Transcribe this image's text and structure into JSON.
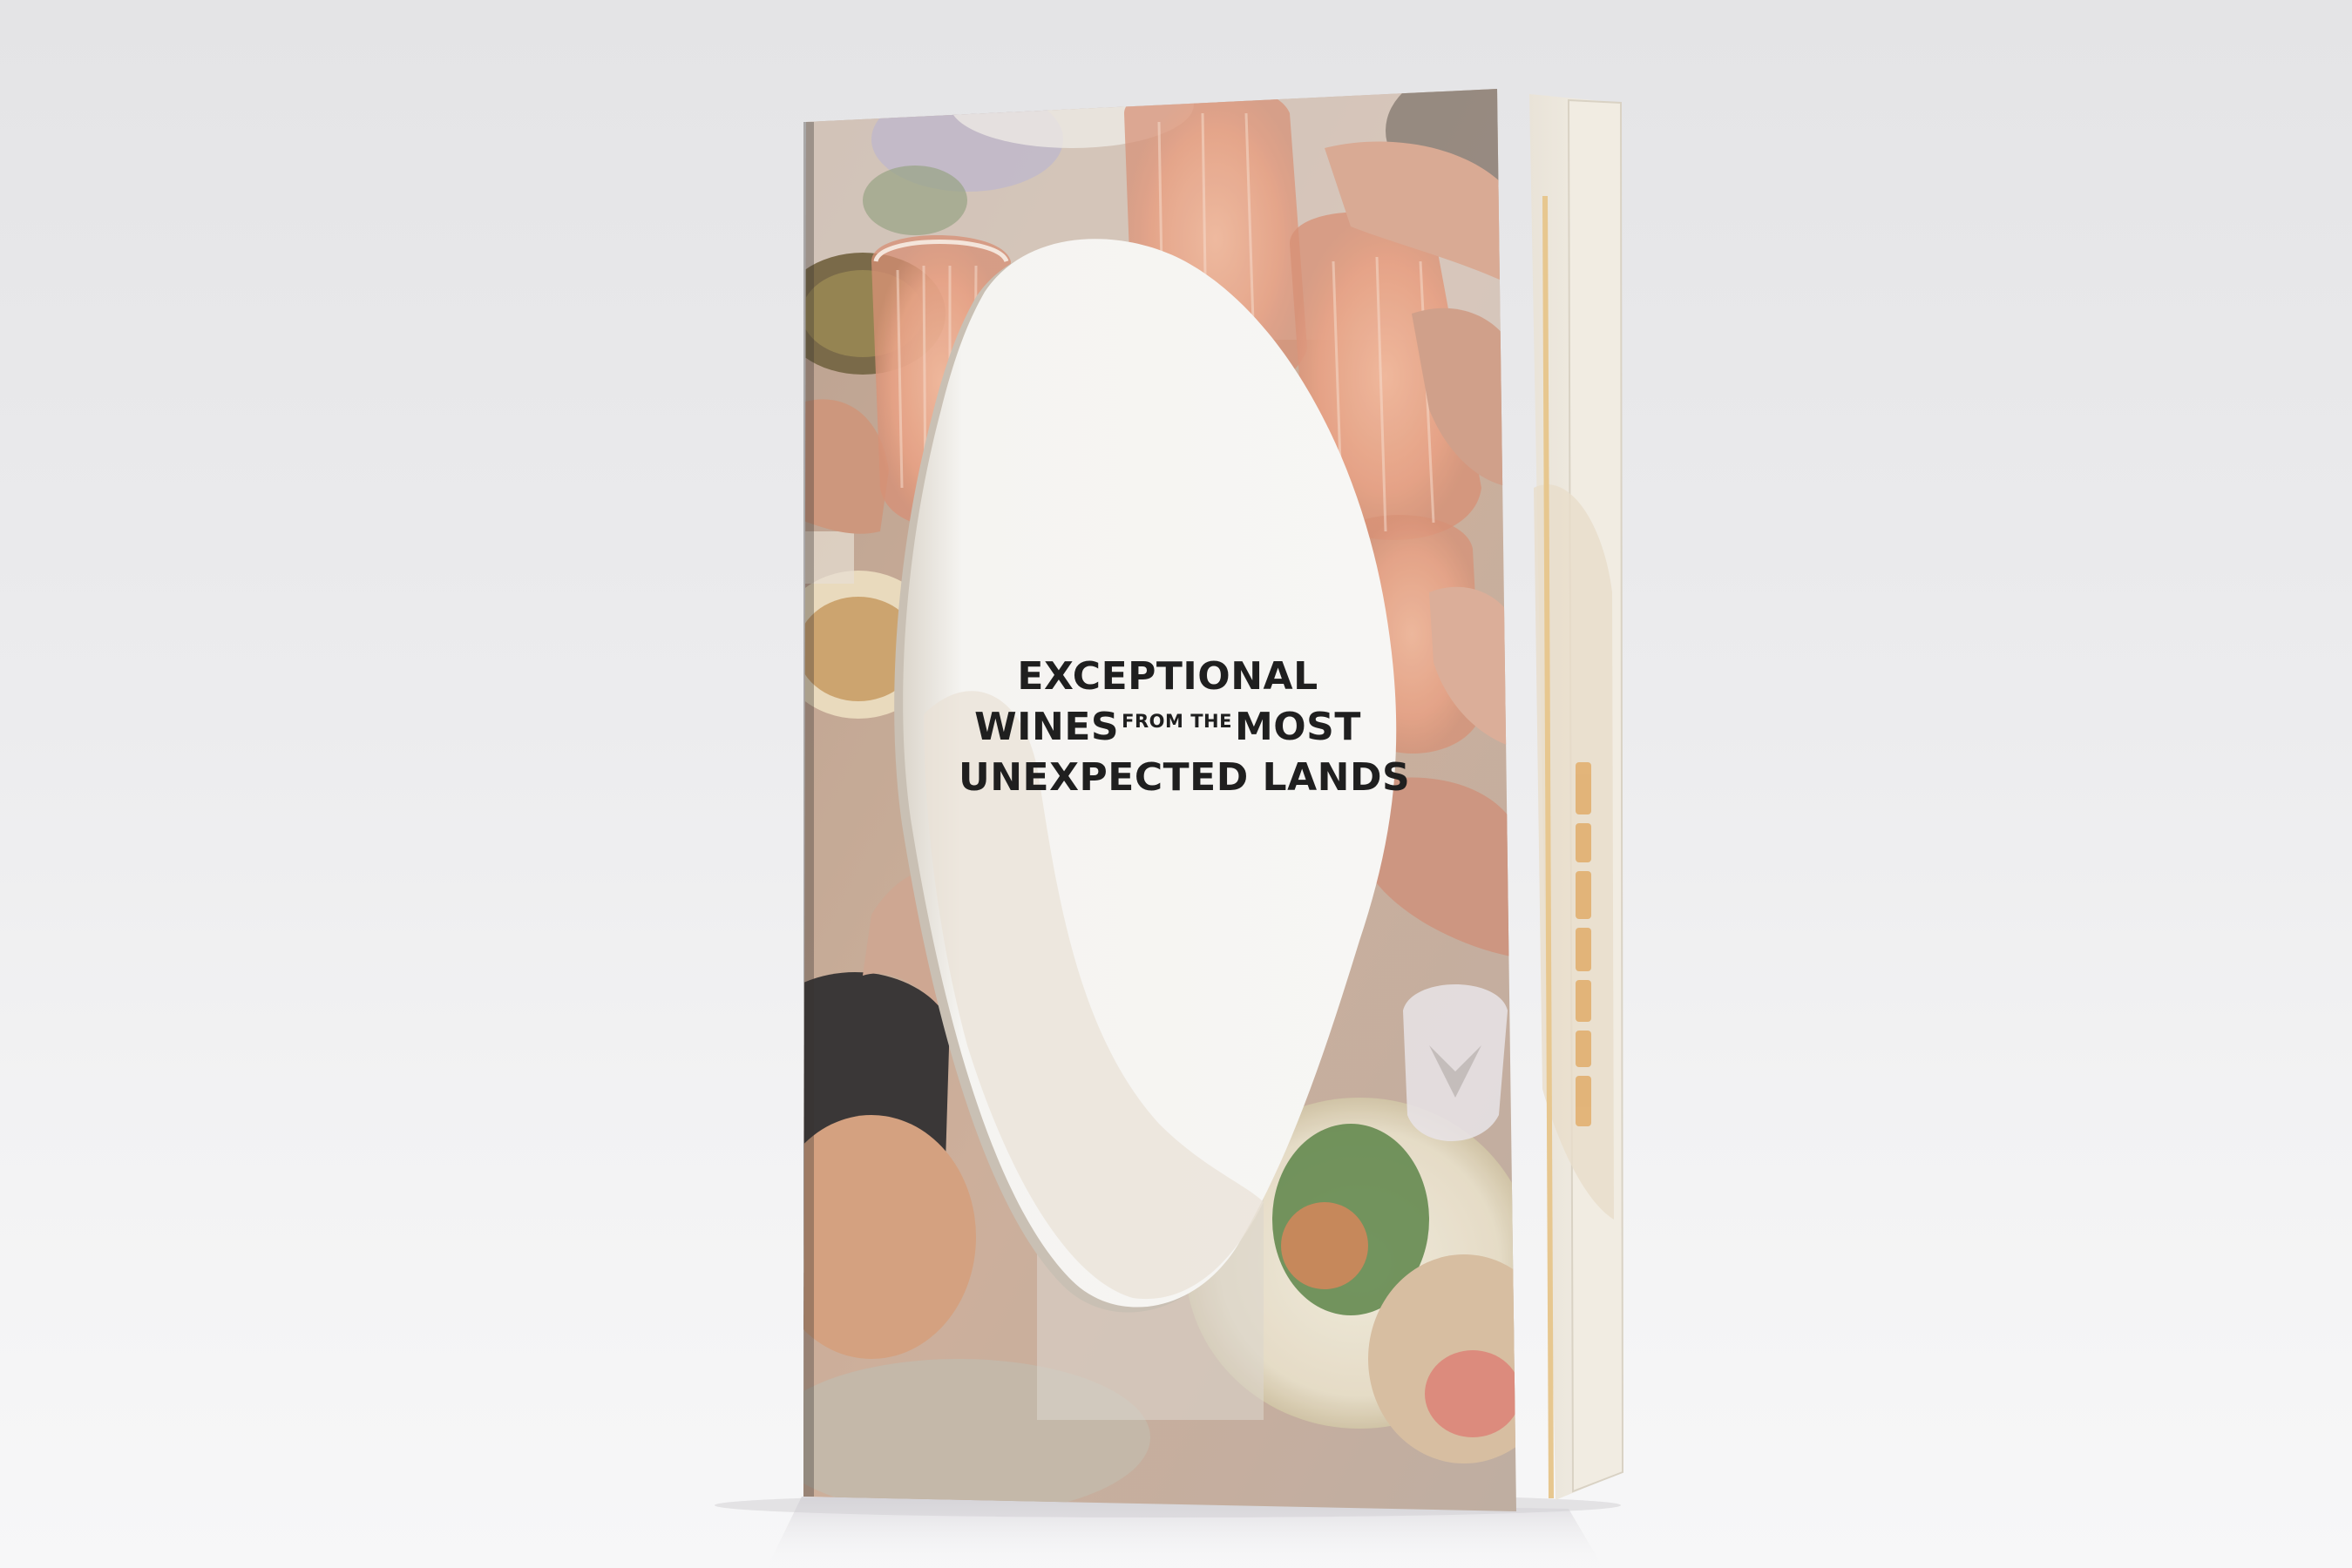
{
  "cover": {
    "title_line1": "EXCEPTIONAL",
    "title_line2_big1": "WINES",
    "title_line2_small": "FROM THE",
    "title_line2_big2": "MOST",
    "title_line3": "UNEXPECTED LANDS"
  },
  "colors": {
    "background": "#ebebed",
    "cutout_paper": "#f4f3f1",
    "wine_rose": "#e7a184",
    "spine_accent": "#e2b070",
    "title_text": "#1f1f1f"
  }
}
